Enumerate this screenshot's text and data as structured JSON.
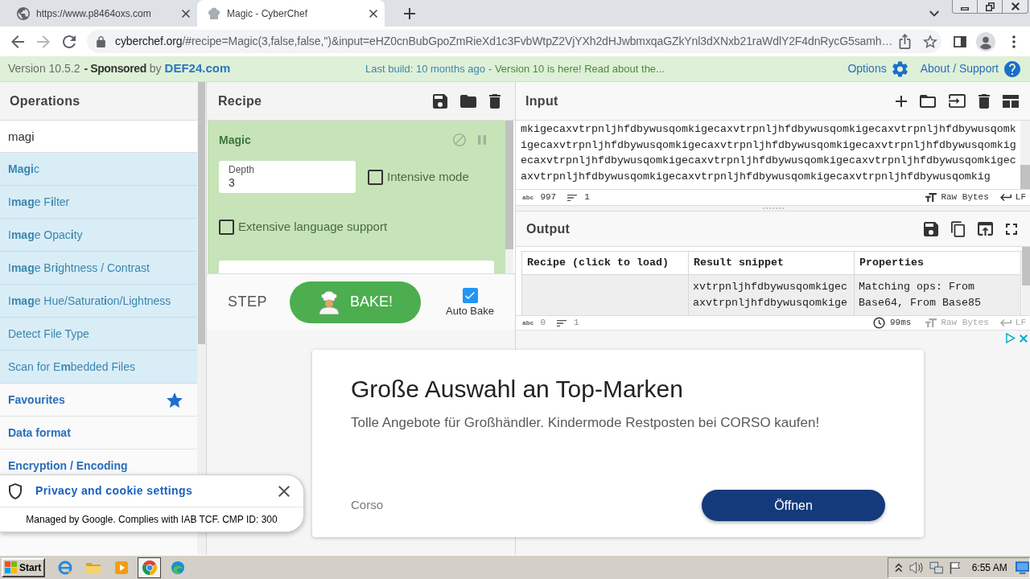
{
  "browser": {
    "tabs": [
      {
        "title": "https://www.p8464oxs.com",
        "selected": false
      },
      {
        "title": "Magic - CyberChef",
        "selected": true
      }
    ],
    "address": {
      "host": "cyberchef.org",
      "path": "/#recipe=Magic(3,false,false,'')&input=eHZ0cnBubGpoZmRieXd1c3FvbWtpZ2VjYXh2dHJwbmxqaGZkYnl3dXNxb21raWdlY2F4dnRycG5samh…"
    }
  },
  "banner": {
    "version": "Version 10.5.2",
    "sponsored": "- Sponsored",
    "by": "by",
    "sponsor": "DEF24.com",
    "build": "Last build: 10 months ago",
    "news": "- Version 10 is here! Read about the...",
    "links": [
      "Options",
      "About / Support"
    ]
  },
  "operations": {
    "title": "Operations",
    "search": {
      "value": "magi"
    },
    "results": [
      "**Magi**c",
      "I**mag**e F**i**lter",
      "I**mag**e Opac**i**ty",
      "I**mag**e Br**i**ghtness / Contrast",
      "I**mag**e Hue/Saturat**i**on/Lightness",
      "Detect File Type",
      "Scan for E**m**bedded Files"
    ],
    "categories": [
      {
        "label": "Favourites",
        "kind": "favourites"
      },
      {
        "label": "Data format",
        "kind": "category"
      },
      {
        "label": "Encryption / Encoding",
        "kind": "category"
      }
    ]
  },
  "recipe": {
    "title": "Recipe",
    "operations": [
      {
        "name": "Magic",
        "args": [
          {
            "kind": "number",
            "label": "Depth",
            "value": "3"
          },
          {
            "kind": "checkbox",
            "label": "Intensive mode",
            "checked": false
          },
          {
            "kind": "checkbox",
            "label": "Extensive language support",
            "checked": false
          },
          {
            "kind": "text"
          }
        ]
      }
    ]
  },
  "bake": {
    "step": "STEP",
    "bake": "BAKE!",
    "auto_bake": {
      "label": "Auto Bake",
      "checked": true
    }
  },
  "input": {
    "title": "Input",
    "text": "mkigecaxvtrpnljhfdbywusqomkigecaxvtrpnljhfdbywusqomkigecaxvtrpnljhfdbywusqomkigecaxvtrpnljhfdbywusqomkigecaxvtrpnljhfdbywusqomkigecaxvtrpnljhfdbywusqomkigecaxvtrpnljhfdbywusqomkigecaxvtrpnljhfdbywusqomkigecaxvtrpnljhfdbywusqomkigecaxvtrpnljhfdbywusqomkigecaxvtrpnljhfdbywusqomkigecaxvtrpnljhfdbywusqomkig",
    "status": {
      "length_glyph": "abc",
      "length": "997",
      "lines": "1",
      "format": "Raw Bytes",
      "eol": "LF",
      "disabled": false
    }
  },
  "output": {
    "title": "Output",
    "table": {
      "columns": [
        "Recipe (click to load)",
        "Result snippet",
        "Properties"
      ],
      "rows": [
        {
          "result": "xvtrpnljhfdbywusqomkigecaxvtrpnljhfdbywusqomkige",
          "properties": "Matching ops: From Base64, From Base85"
        }
      ]
    },
    "status": {
      "length_glyph": "abc",
      "length": "0",
      "lines": "1",
      "time": "99ms",
      "format": "Raw Bytes",
      "eol": "LF",
      "disabled": true
    }
  },
  "ad": {
    "headline": "Große Auswahl an Top-Marken",
    "text": "Tolle Angebote für Großhändler. Kindermode Restposten bei CORSO kaufen!",
    "advertiser": "Corso",
    "button": "Öffnen"
  },
  "cookie_notice": {
    "title": "Privacy and cookie settings",
    "text": "Managed by Google. Complies with IAB TCF. CMP ID: 300"
  },
  "taskbar": {
    "start": "Start",
    "apps": [
      {
        "selected": false
      },
      {
        "selected": false
      },
      {
        "selected": false
      },
      {
        "selected": true
      },
      {
        "selected": false
      }
    ],
    "clock": "6:55 AM"
  }
}
